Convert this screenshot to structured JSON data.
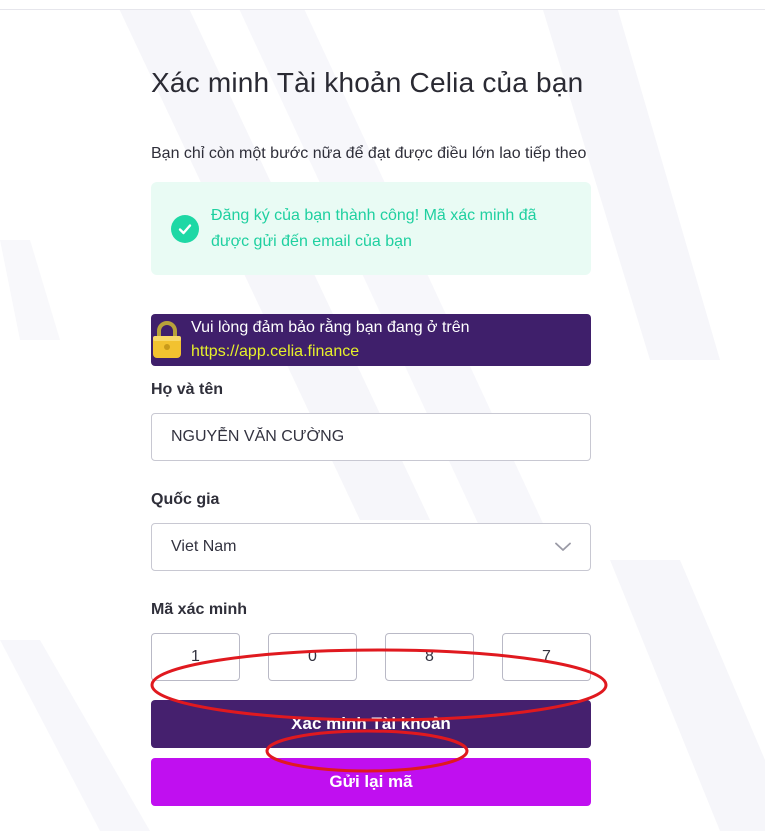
{
  "page": {
    "title": "Xác minh Tài khoản Celia của bạn",
    "subtitle": "Bạn chỉ còn một bước nữa để đạt được điều lớn lao tiếp theo"
  },
  "success": {
    "message": "Đăng ký của bạn thành công! Mã xác minh đã được gửi đến email của bạn",
    "icon": "check-circle-icon"
  },
  "notice": {
    "text": "Vui lòng đảm bảo rằng bạn đang ở trên",
    "url": "https://app.celia.finance",
    "icon": "lock-icon"
  },
  "form": {
    "name_label": "Họ và tên",
    "name_value": "NGUYỄN VĂN CƯỜNG",
    "country_label": "Quốc gia",
    "country_value": "Viet Nam",
    "code_label": "Mã xác minh",
    "code_digits": [
      "1",
      "0",
      "8",
      "7"
    ]
  },
  "buttons": {
    "verify": "Xác minh Tài khoản",
    "resend": "Gửi lại mã"
  },
  "colors": {
    "primary_purple": "#45206e",
    "resend_magenta": "#c00ff0",
    "success_green": "#1fd0a0",
    "success_bg": "#e9fbf4",
    "url_yellow": "#e6f02a",
    "annotation_red": "#e0191f"
  }
}
